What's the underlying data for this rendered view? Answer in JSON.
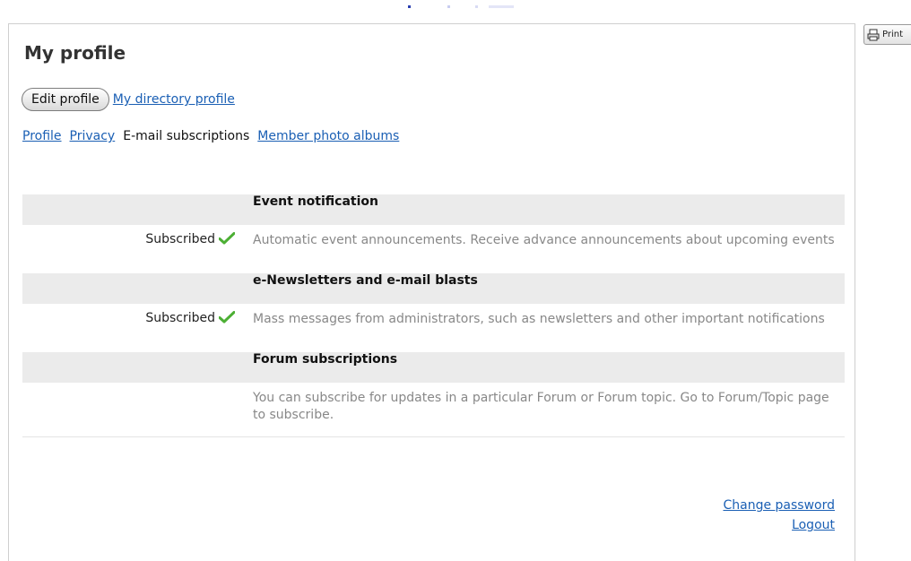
{
  "print": {
    "label": "Print"
  },
  "page": {
    "title": "My profile"
  },
  "actions": {
    "edit_profile": "Edit profile",
    "directory_profile": "My directory profile"
  },
  "tabs": [
    {
      "label": "Profile",
      "active": false
    },
    {
      "label": "Privacy",
      "active": false
    },
    {
      "label": "E-mail subscriptions",
      "active": true
    },
    {
      "label": "Member photo albums",
      "active": false
    }
  ],
  "subscriptions": [
    {
      "heading": "Event notification",
      "status": "Subscribed",
      "description": "Automatic event announcements. Receive advance announcements about upcoming events"
    },
    {
      "heading": "e-Newsletters and e-mail blasts",
      "status": "Subscribed",
      "description": "Mass messages from administrators, such as newsletters and other important notifications"
    },
    {
      "heading": "Forum subscriptions",
      "status": "",
      "description": "You can subscribe for updates in a particular Forum or Forum topic. Go to Forum/Topic page to subscribe."
    }
  ],
  "footer": {
    "change_password": "Change password",
    "logout": "Logout"
  },
  "colors": {
    "link": "#1a5fb4",
    "header_row_bg": "#ebebeb",
    "check_green": "#4caf34",
    "muted_text": "#888888"
  }
}
